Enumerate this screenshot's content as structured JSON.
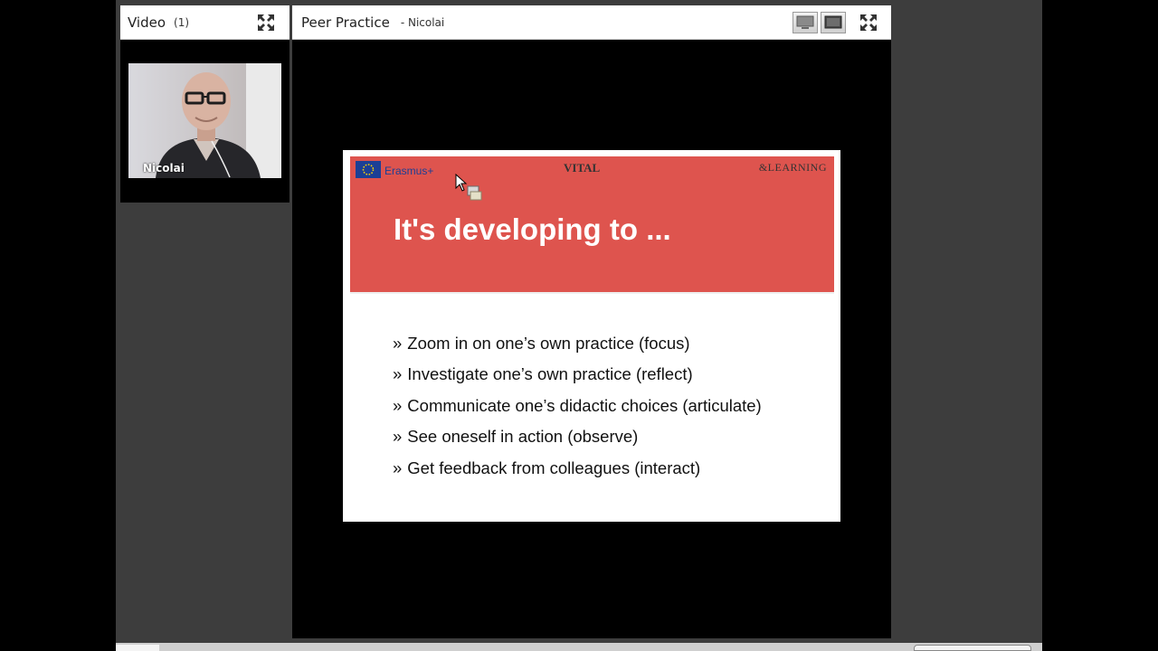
{
  "video_pod": {
    "title": "Video",
    "count": "(1)",
    "participant_name": "Nicolai"
  },
  "share_pod": {
    "title": "Peer Practice",
    "presenter": "- Nicolai"
  },
  "slide": {
    "banner_left_label": "Erasmus+",
    "banner_center_logo": "VITAL",
    "banner_right_logo": "&LEARNING",
    "title": "It's developing to ...",
    "bullet_mark": "»",
    "bullets": [
      "Zoom in on one’s own practice (focus)",
      "Investigate one’s own practice (reflect)",
      "Communicate one’s didactic choices (articulate)",
      "See oneself in action (observe)",
      "Get feedback from colleagues (interact)"
    ]
  },
  "colors": {
    "banner": "#de544e",
    "erasmus_blue": "#1c3f95",
    "app_background": "#3d3d3d"
  },
  "icons": [
    "fullscreen-icon",
    "desktop-view-icon",
    "fit-view-icon",
    "pointer-cursor-icon",
    "eu-flag-icon"
  ]
}
